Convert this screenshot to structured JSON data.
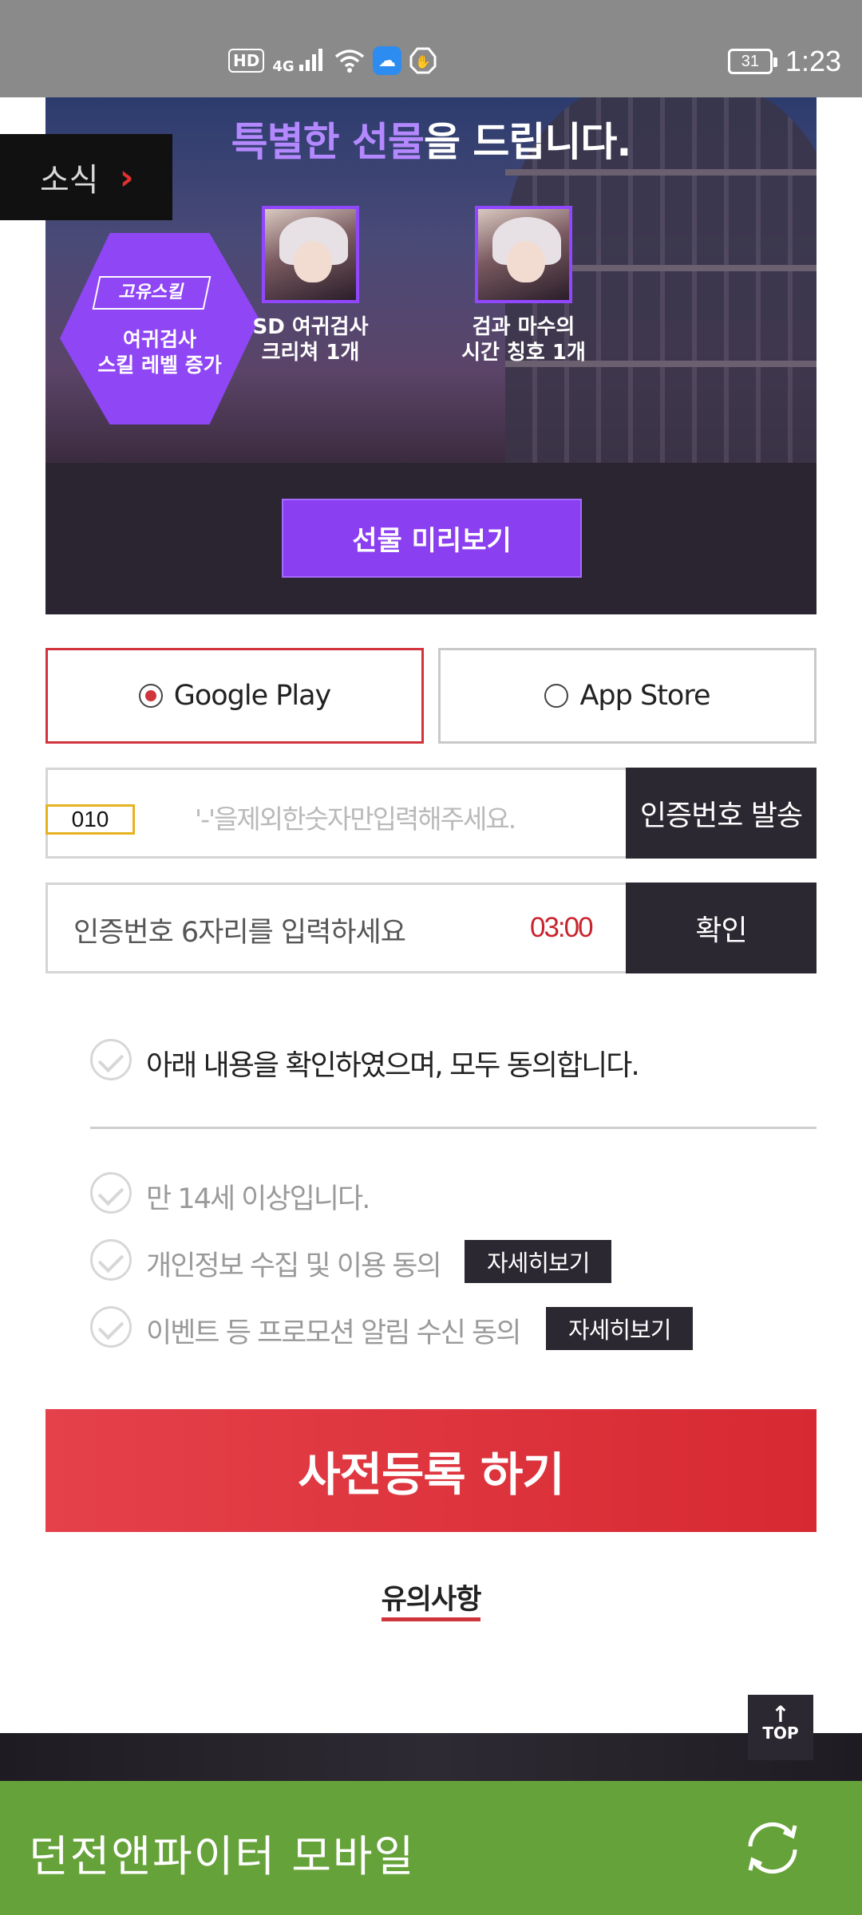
{
  "status_bar": {
    "left_icons": [
      "hd-icon",
      "4g-signal-icon",
      "wifi-icon",
      "cloud-icon",
      "hand-icon"
    ],
    "hd_label": "HD",
    "network_label": "4G",
    "battery": "31",
    "time": "1:23"
  },
  "banner": {
    "headline_highlight": "특별한 선물",
    "headline_rest": "을 드립니다.",
    "badge_skill_label": "고유스킬",
    "badge_line1": "여귀검사",
    "badge_line2": "스킬 레벨 증가",
    "gifts": [
      {
        "line1": "SD 여귀검사",
        "line2": "크리쳐 1개"
      },
      {
        "line1": "검과 마수의",
        "line2": "시간 칭호 1개"
      }
    ],
    "preview_button": "선물 미리보기"
  },
  "news_tab": {
    "label": "소식",
    "arrow": "›"
  },
  "stores": [
    {
      "label": "Google Play",
      "selected": true
    },
    {
      "label": "App Store",
      "selected": false
    }
  ],
  "phone": {
    "prefix": "010",
    "placeholder": "'-'을제외한숫자만입력해주세요.",
    "send_button": "인증번호 발송"
  },
  "verify": {
    "placeholder": "인증번호 6자리를 입력하세요",
    "timer": "03:00",
    "confirm_button": "확인"
  },
  "agreements": {
    "all": "아래 내용을 확인하였으며, 모두 동의합니다.",
    "items": [
      {
        "label": "만 14세 이상입니다.",
        "detail": ""
      },
      {
        "label": "개인정보 수집 및 이용 동의",
        "detail": "자세히보기"
      },
      {
        "label": "이벤트 등 프로모션 알림 수신 동의",
        "detail": "자세히보기"
      }
    ]
  },
  "register_button": "사전등록 하기",
  "notice_link": "유의사항",
  "top_button": {
    "arrow": "↑",
    "label": "TOP"
  },
  "bottom_bar": {
    "title": "던전앤파이터 모바일"
  },
  "colors": {
    "accent_red": "#d0343c",
    "purple": "#8a3ff0",
    "bottom_green": "#66a23a",
    "dark": "#2b2831"
  }
}
